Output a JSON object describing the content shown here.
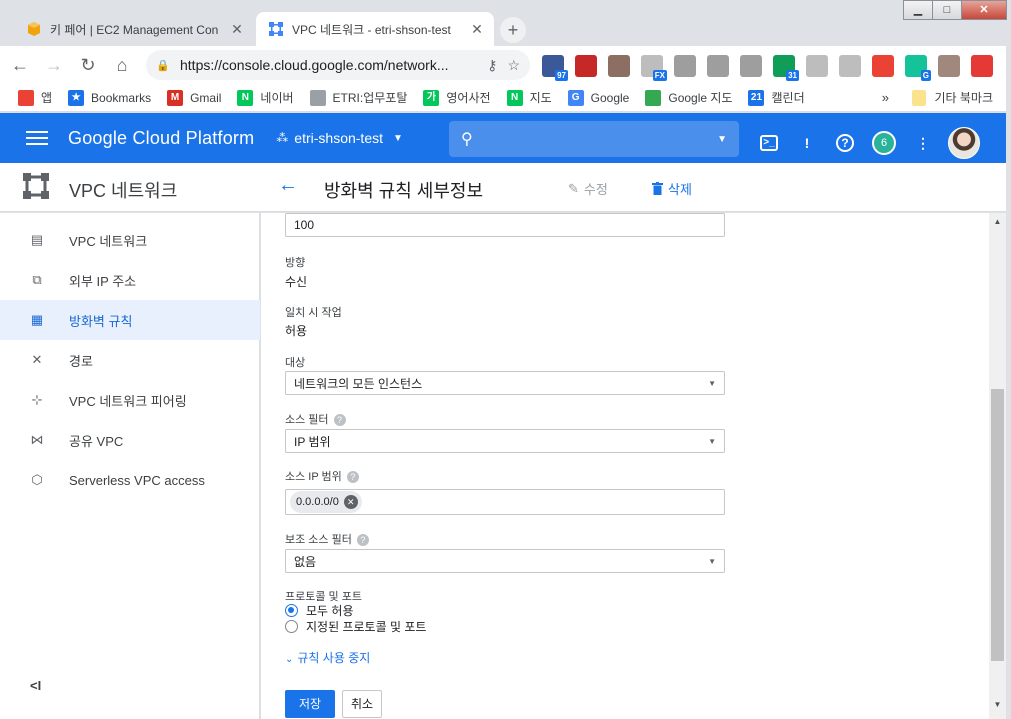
{
  "browser": {
    "tabs": [
      {
        "title": "키 페어 | EC2 Management Con",
        "close": "✕"
      },
      {
        "title": "VPC 네트워크 - etri-shson-test",
        "close": "✕"
      }
    ],
    "new_tab": "+",
    "window_controls": {
      "minimize": "▁",
      "maximize": "□",
      "close": "✕"
    },
    "url": "https://console.cloud.google.com/network...",
    "extensions": [
      {
        "label": "97",
        "color": "#3b5998"
      },
      {
        "label": "",
        "color": "#c62828"
      },
      {
        "label": "",
        "color": "#8d6e63"
      },
      {
        "label": "FX",
        "color": "#bdbdbd"
      },
      {
        "label": "",
        "color": "#9e9e9e"
      },
      {
        "label": "",
        "color": "#9e9e9e"
      },
      {
        "label": "",
        "color": "#9e9e9e"
      },
      {
        "label": "31",
        "color": "#0f9d58"
      },
      {
        "label": "",
        "color": "#bdbdbd"
      },
      {
        "label": "",
        "color": "#bdbdbd"
      },
      {
        "label": "",
        "color": "#ea4335"
      },
      {
        "label": "G",
        "color": "#15c39a"
      },
      {
        "label": "",
        "color": "#a1887f"
      },
      {
        "label": "",
        "color": "#e53935"
      }
    ],
    "bookmarks": [
      {
        "label": "앱",
        "icon_color": "#ea4335",
        "icon": ""
      },
      {
        "label": "Bookmarks",
        "icon_color": "#1a73e8",
        "icon": "★"
      },
      {
        "label": "Gmail",
        "icon_color": "#d93025",
        "icon": "M"
      },
      {
        "label": "네이버",
        "icon_color": "#03c75a",
        "icon": "N"
      },
      {
        "label": "ETRI:업무포탈",
        "icon_color": "#9aa0a6",
        "icon": ""
      },
      {
        "label": "영어사전",
        "icon_color": "#03c75a",
        "icon": "가"
      },
      {
        "label": "지도",
        "icon_color": "#03c75a",
        "icon": "N"
      },
      {
        "label": "Google",
        "icon_color": "#4285f4",
        "icon": "G"
      },
      {
        "label": "Google 지도",
        "icon_color": "#34a853",
        "icon": ""
      },
      {
        "label": "캘린더",
        "icon_color": "#1a73e8",
        "icon": "21"
      }
    ],
    "bookmarks_more": "»",
    "other_bookmarks": "기타 북마크"
  },
  "gcp": {
    "title": "Google Cloud Platform",
    "project": "etri-shson-test",
    "notifications": "6"
  },
  "app": {
    "product_name": "VPC 네트워크",
    "page_title": "방화벽 규칙 세부정보",
    "edit_label": "수정",
    "delete_label": "삭제"
  },
  "sidebar": {
    "items": [
      {
        "label": "VPC 네트워크",
        "icon": "▤"
      },
      {
        "label": "외부 IP 주소",
        "icon": "⧉"
      },
      {
        "label": "방화벽 규칙",
        "icon": "▦"
      },
      {
        "label": "경로",
        "icon": "✕"
      },
      {
        "label": "VPC 네트워크 피어링",
        "icon": "⊹"
      },
      {
        "label": "공유 VPC",
        "icon": "⋈"
      },
      {
        "label": "Serverless VPC access",
        "icon": "⬡"
      }
    ],
    "collapse": "<I"
  },
  "form": {
    "priority_value": "100",
    "direction_label": "방향",
    "direction_value": "수신",
    "action_label": "일치 시 작업",
    "action_value": "허용",
    "target_label": "대상",
    "target_value": "네트워크의 모든 인스턴스",
    "source_filter_label": "소스 필터",
    "source_filter_value": "IP 범위",
    "source_ip_label": "소스 IP 범위",
    "source_ip_chip": "0.0.0.0/0",
    "secondary_filter_label": "보조 소스 필터",
    "secondary_filter_value": "없음",
    "protocol_label": "프로토콜 및 포트",
    "protocol_options": [
      "모두 허용",
      "지정된 프로토콜 및 포트"
    ],
    "disable_rule": "규칙 사용 중지",
    "save": "저장",
    "cancel": "취소"
  },
  "colors": {
    "accent": "#1a73e8",
    "active_nav_bg": "#e8f0fe"
  }
}
